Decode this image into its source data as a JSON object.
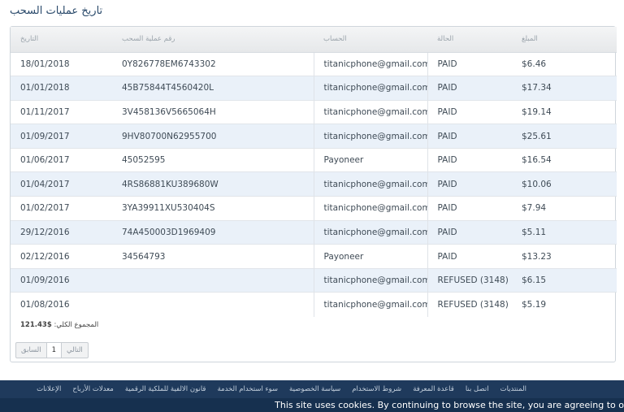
{
  "page": {
    "title": "تاريخ عمليات السحب"
  },
  "table": {
    "headers": [
      "التاريخ",
      "رقم عملية السحب",
      "الحساب",
      "الحالة",
      "المبلغ"
    ],
    "rows": [
      [
        "18/01/2018",
        "0Y826778EM6743302",
        "titanicphone@gmail.com",
        "PAID",
        "$6.46"
      ],
      [
        "01/01/2018",
        "45B75844T4560420L",
        "titanicphone@gmail.com",
        "PAID",
        "$17.34"
      ],
      [
        "01/11/2017",
        "3V458136V5665064H",
        "titanicphone@gmail.com",
        "PAID",
        "$19.14"
      ],
      [
        "01/09/2017",
        "9HV80700N62955700",
        "titanicphone@gmail.com",
        "PAID",
        "$25.61"
      ],
      [
        "01/06/2017",
        "45052595",
        "Payoneer",
        "PAID",
        "$16.54"
      ],
      [
        "01/04/2017",
        "4RS86881KU389680W",
        "titanicphone@gmail.com",
        "PAID",
        "$10.06"
      ],
      [
        "01/02/2017",
        "3YA39911XU530404S",
        "titanicphone@gmail.com",
        "PAID",
        "$7.94"
      ],
      [
        "29/12/2016",
        "74A450003D1969409",
        "titanicphone@gmail.com",
        "PAID",
        "$5.11"
      ],
      [
        "02/12/2016",
        "34564793",
        "Payoneer",
        "PAID",
        "$13.23"
      ],
      [
        "01/09/2016",
        "",
        "titanicphone@gmail.com",
        "REFUSED (3148)",
        "$6.15"
      ],
      [
        "01/08/2016",
        "",
        "titanicphone@gmail.com",
        "REFUSED (3148)",
        "$5.19"
      ]
    ]
  },
  "total": {
    "label": "المجموع الكلي:",
    "value": "$121.43"
  },
  "pager": {
    "prev": "السابق",
    "current": "1",
    "next": "التالي"
  },
  "footer_nav": [
    "المنتديات",
    "اتصل بنا",
    "قاعدة المعرفة",
    "شروط الاستخدام",
    "سياسة الخصوصية",
    "سوء استخدام الخدمة",
    "قانون الالفية للملكية الرقمية",
    "معدلات الأرباح",
    "الإعلانات"
  ],
  "cookie": {
    "text": "This site uses cookies. By continuing to browse the site, you are agreeing to o"
  },
  "colors": {
    "footer": "#1f3a5c",
    "row_alt": "#eaf1f9",
    "title": "#2a4a6b"
  }
}
